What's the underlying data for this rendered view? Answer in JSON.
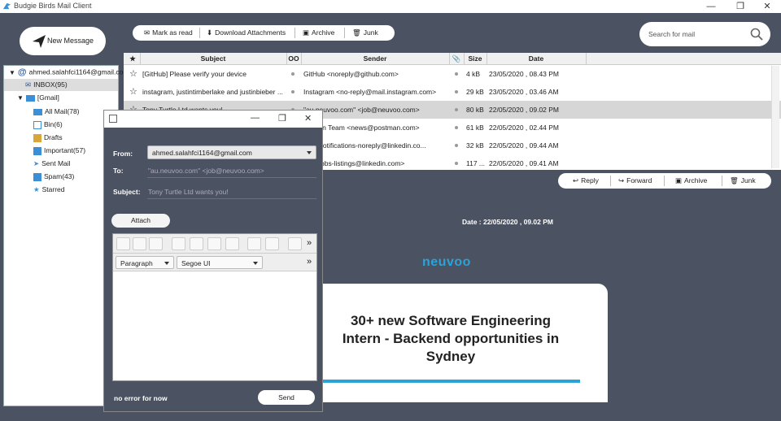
{
  "window": {
    "title": "Budgie Birds Mail Client",
    "minimize": "—",
    "maximize": "❐",
    "close": "✕"
  },
  "new_message_label": "New Message",
  "folders": {
    "account": "ahmed.salahfci1164@gmail.com",
    "inbox": "INBOX(95)",
    "gmail": "[Gmail]",
    "all_mail": "All Mail(78)",
    "bin": "Bin(6)",
    "drafts": "Drafts",
    "important": "Important(57)",
    "sent": "Sent Mail",
    "spam": "Spam(43)",
    "starred": "Starred"
  },
  "toolbar": {
    "mark_read": "Mark as read",
    "download": "Download Attachments",
    "archive": "Archive",
    "junk": "Junk"
  },
  "search": {
    "placeholder": "Search for mail"
  },
  "table": {
    "headers": {
      "star": "★",
      "subject": "Subject",
      "oo": "OO",
      "sender": "Sender",
      "size": "Size",
      "date": "Date"
    },
    "rows": [
      {
        "subject": "[GitHub] Please verify your device",
        "sender": "GitHub <noreply@github.com>",
        "size": "4 kB",
        "date": "23/05/2020 , 08.43 PM"
      },
      {
        "subject": "instagram, justintimberlake and justinbieber ...",
        "sender": "Instagram <no-reply@mail.instagram.com>",
        "size": "29 kB",
        "date": "23/05/2020 , 03.46 AM"
      },
      {
        "subject": "Tony Turtle Ltd wants you!",
        "sender": "\"au.neuvoo.com\" <job@neuvoo.com>",
        "size": "80 kB",
        "date": "22/05/2020 , 09.02 PM"
      },
      {
        "subject": "",
        "sender": "ostman Team <news@postman.com>",
        "size": "61 kB",
        "date": "22/05/2020 , 02.44 PM"
      },
      {
        "subject": "",
        "sender": "dIn <notifications-noreply@linkedin.co...",
        "size": "32 kB",
        "date": "22/05/2020 , 09.44 AM"
      },
      {
        "subject": "",
        "sender": "dIn <jobs-listings@linkedin.com>",
        "size": "117 ...",
        "date": "22/05/2020 , 09.41 AM"
      }
    ]
  },
  "actions": {
    "reply": "Reply",
    "forward": "Forward",
    "archive": "Archive",
    "junk": "Junk"
  },
  "preview": {
    "date": "Date : 22/05/2020 , 09.02 PM",
    "brand": "neuvoo",
    "headline_1": "30+ new Software Engineering",
    "headline_2": "Intern - Backend opportunities in",
    "headline_3": "Sydney"
  },
  "compose": {
    "from_label": "From:",
    "from_value": "ahmed.salahfci1164@gmail.com",
    "to_label": "To:",
    "to_value": "\"au.neuvoo.com\" <job@neuvoo.com>",
    "subject_label": "Subject:",
    "subject_value": "Tony Turtle Ltd wants you!",
    "attach": "Attach",
    "more": "»",
    "paragraph": "Paragraph",
    "font": "Segoe UI",
    "status": "no error for now",
    "send": "Send"
  },
  "colors": {
    "panel": "#4b5262",
    "accent": "#2aa3d8",
    "selected_row": "#d6d6d6"
  }
}
